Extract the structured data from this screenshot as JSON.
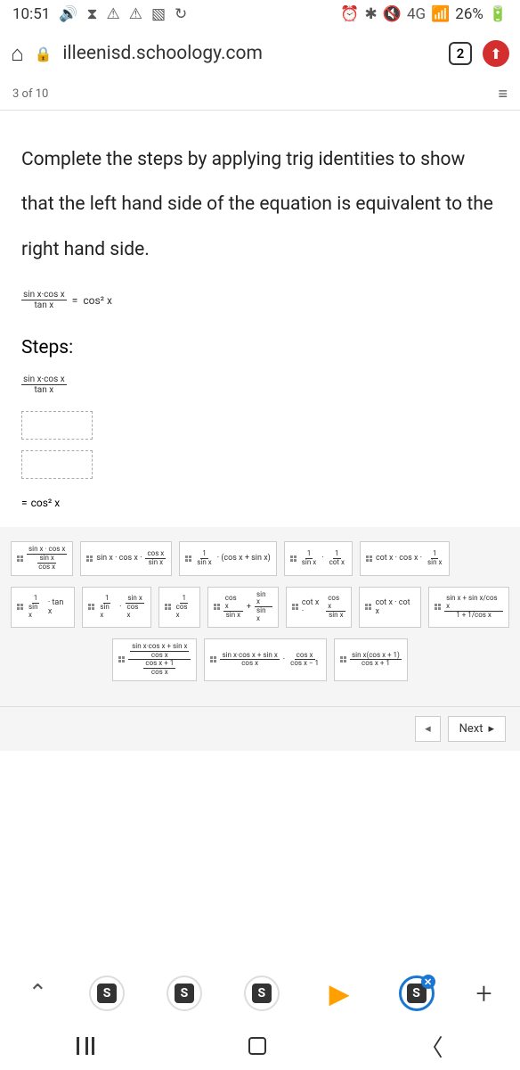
{
  "status": {
    "time": "10:51",
    "battery": "26%",
    "network": "4G"
  },
  "browser": {
    "url": "illeenisd.schoology.com",
    "tab_count": "2"
  },
  "progress": "3 of 10",
  "prompt": "Complete the steps by applying trig identities to show that the left hand side of the equation is equivalent to the right hand side.",
  "given": {
    "lhs_num": "sin x·cos x",
    "lhs_den": "tan x",
    "eq": "=",
    "rhs": "cos² x"
  },
  "steps_label": "Steps:",
  "step1": {
    "num": "sin x·cos x",
    "den": "tan x"
  },
  "final": {
    "eq": "=",
    "rhs": "cos² x"
  },
  "options": {
    "r1": {
      "a": {
        "num": "sin x · cos x",
        "d1": "sin x",
        "d2": "cos x"
      },
      "b": {
        "pre": "sin x · cos x ·",
        "num": "cos x",
        "den": "sin x"
      },
      "c": {
        "n1": "1",
        "d1": "sin x",
        "post": "· (cos x + sin x)"
      },
      "d": {
        "n1": "1",
        "d1": "sin x",
        "sep": "·",
        "n2": "1",
        "d2": "cot x"
      },
      "e": {
        "pre": "cot x · cos x ·",
        "num": "1",
        "den": "sin x"
      }
    },
    "r2": {
      "a": {
        "n": "1",
        "d": "sin x",
        "post": "· tan x"
      },
      "b": {
        "n1": "1",
        "d1": "sin x",
        "sep": "·",
        "n2": "sin x",
        "d2": "cos x"
      },
      "c": {
        "n": "1",
        "d": "cos x"
      },
      "d": {
        "n1": "cos x",
        "d1": "sin x",
        "sep": "+",
        "n2": "sin x",
        "d2": "sin x"
      },
      "e": {
        "pre": "cot x ·",
        "n": "cos x",
        "d": "sin x"
      },
      "f": "cot x · cot x",
      "g": {
        "nfull": "sin x + sin x/cos x",
        "dfull": "1 + 1/cos x"
      }
    },
    "r3": {
      "a": {
        "top1": "sin x·cos x + sin x",
        "top2": "cos x",
        "bot1": "cos x + 1",
        "bot2": "cos x"
      },
      "b": {
        "n": "sin x·cos x + sin x",
        "d": "cos x",
        "sep": "·",
        "n2": "cos x",
        "d2": "cos x − 1"
      },
      "c": {
        "n": "sin x(cos x + 1)",
        "d": "cos x + 1"
      }
    }
  },
  "nav": {
    "next": "Next",
    "prev": "◂"
  }
}
